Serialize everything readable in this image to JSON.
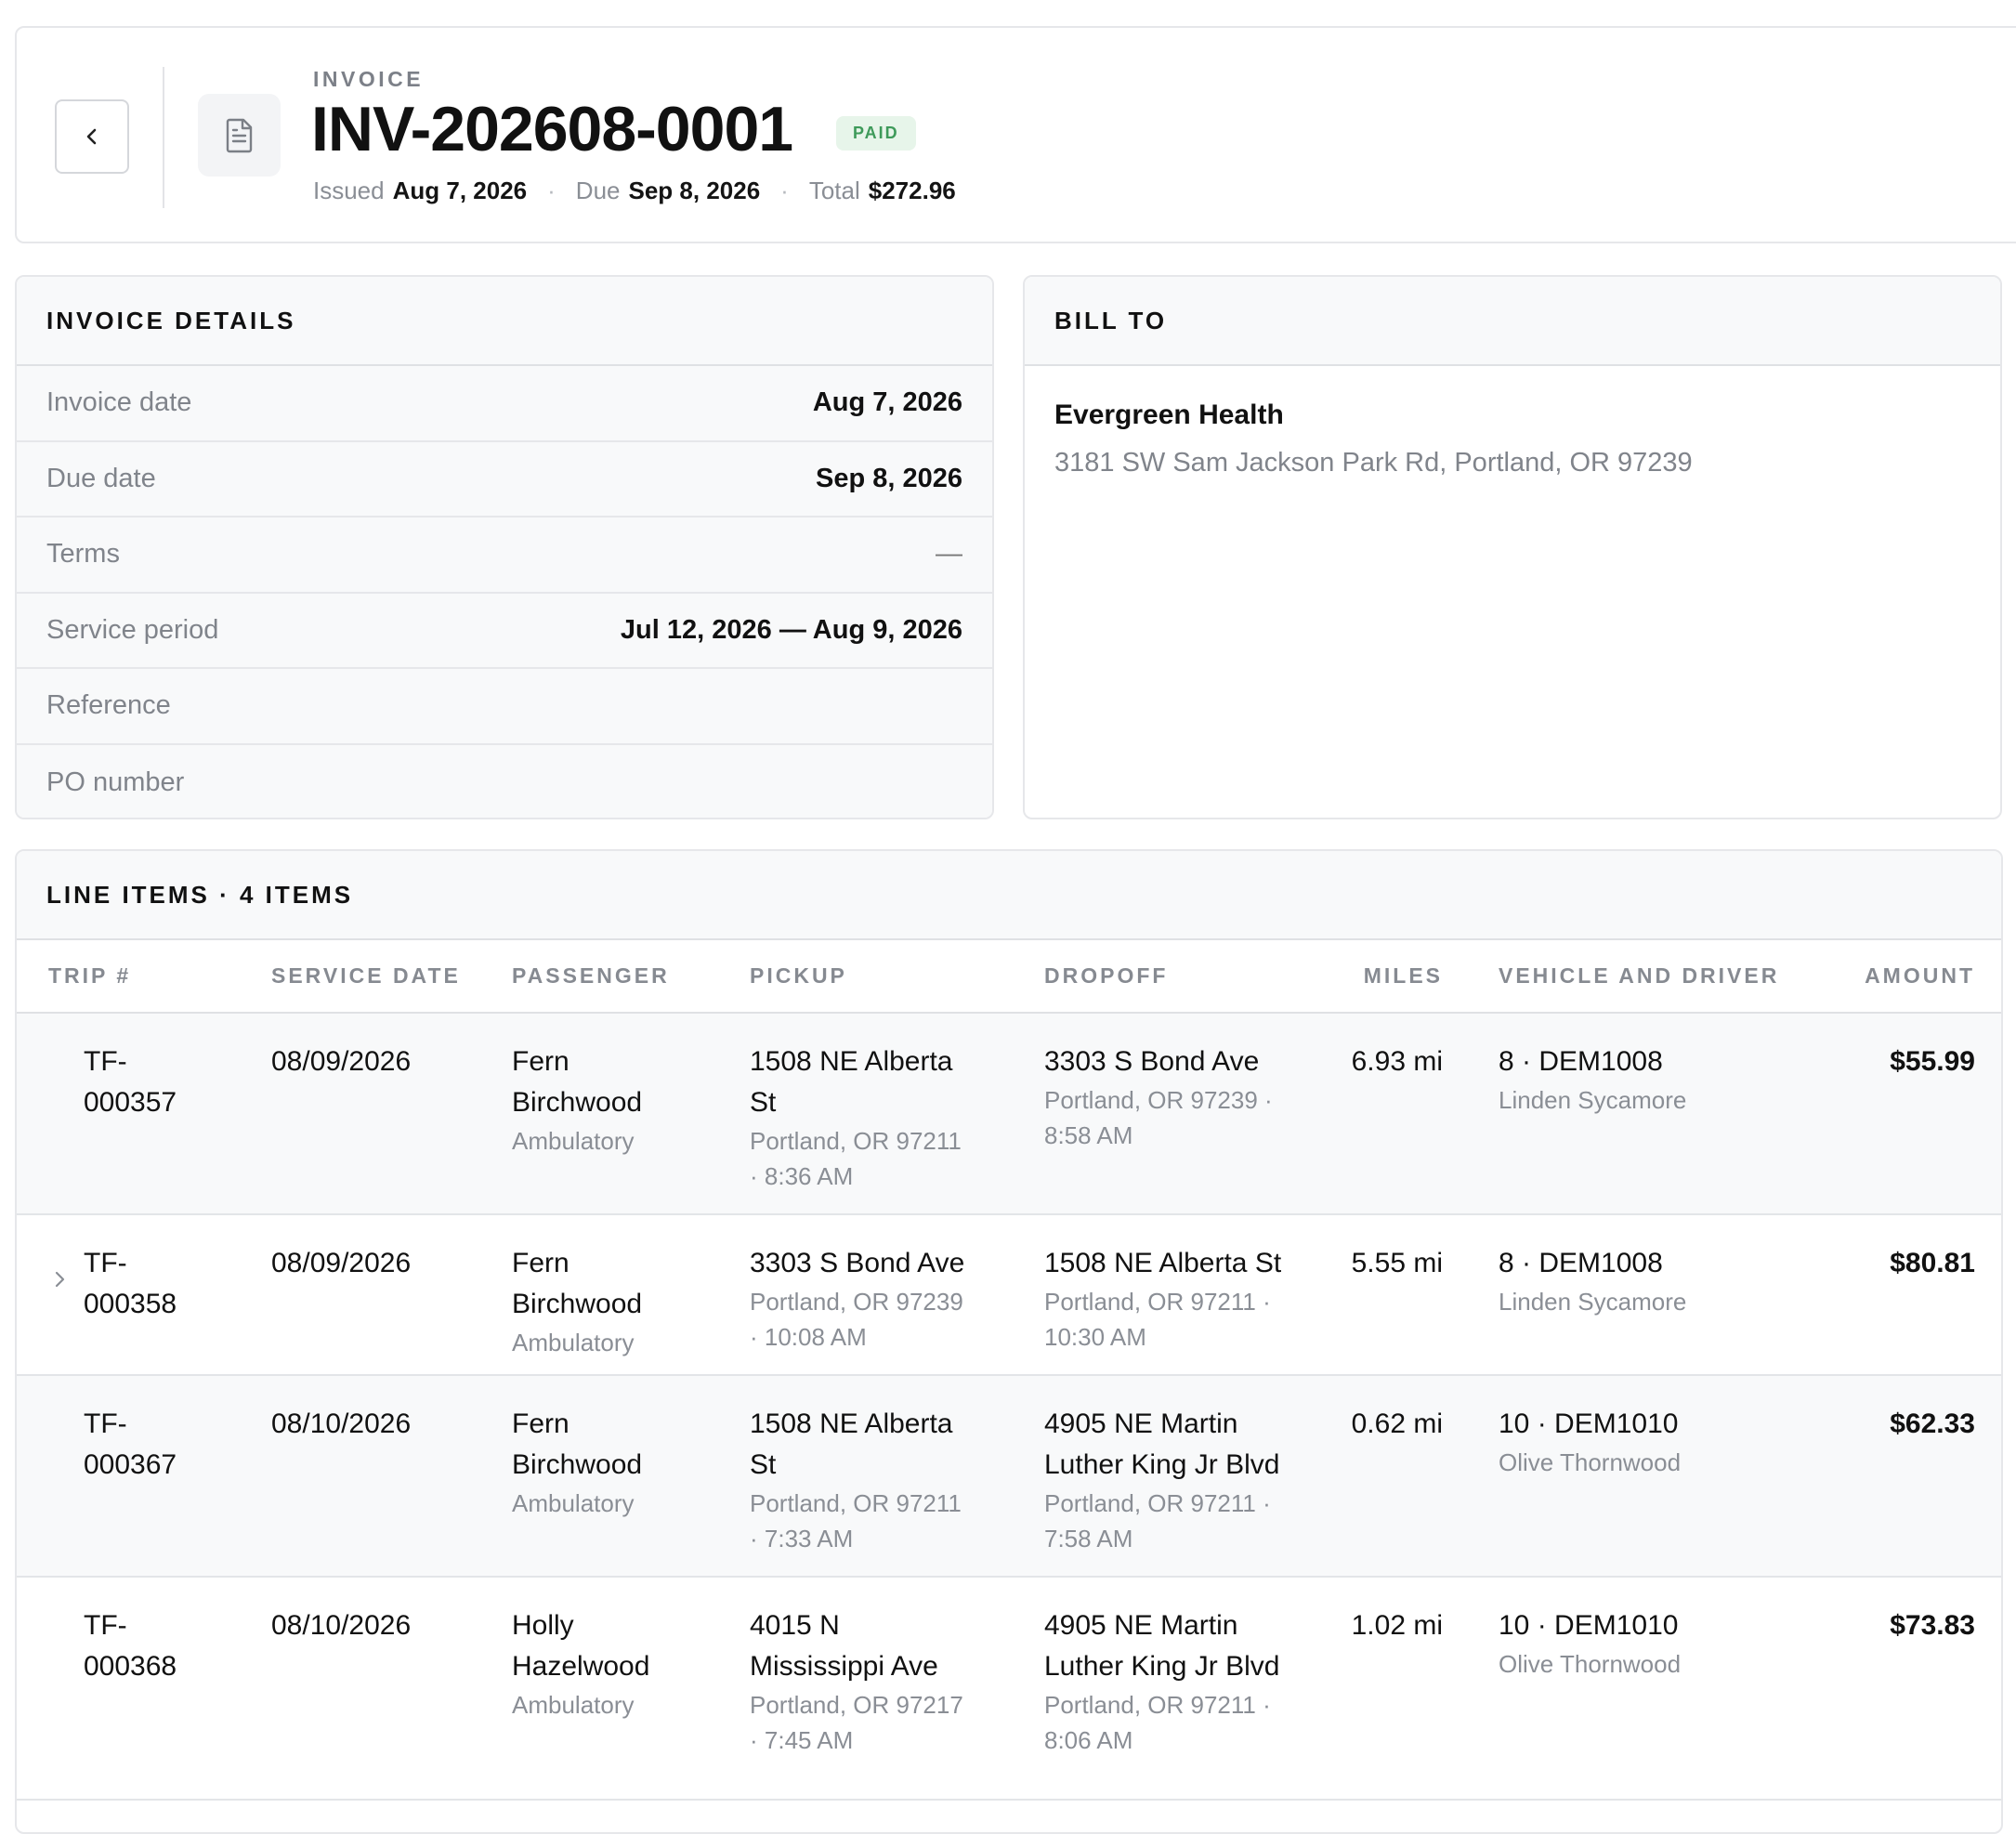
{
  "header": {
    "eyebrow": "INVOICE",
    "invoice_number": "INV-202608-0001",
    "status": "PAID",
    "issued_label": "Issued",
    "issued_value": "Aug 7, 2026",
    "due_label": "Due",
    "due_value": "Sep 8, 2026",
    "total_label": "Total",
    "total_value": "$272.96",
    "separator": "·"
  },
  "details": {
    "title": "INVOICE DETAILS",
    "rows": [
      {
        "label": "Invoice date",
        "value": "Aug 7, 2026"
      },
      {
        "label": "Due date",
        "value": "Sep 8, 2026"
      },
      {
        "label": "Terms",
        "value": "—"
      },
      {
        "label": "Service period",
        "value": "Jul 12, 2026 — Aug 9, 2026"
      },
      {
        "label": "Reference",
        "value": ""
      },
      {
        "label": "PO number",
        "value": ""
      }
    ]
  },
  "bill_to": {
    "title": "BILL TO",
    "name": "Evergreen Health",
    "address": "3181 SW Sam Jackson Park Rd, Portland, OR 97239"
  },
  "line_items": {
    "title": "LINE ITEMS · 4 ITEMS",
    "columns": {
      "trip": "TRIP #",
      "service_date": "SERVICE DATE",
      "passenger": "PASSENGER",
      "pickup": "PICKUP",
      "dropoff": "DROPOFF",
      "miles": "MILES",
      "vehicle_driver": "VEHICLE AND DRIVER",
      "amount": "AMOUNT"
    },
    "rows": [
      {
        "trip_a": "TF-",
        "trip_b": "000357",
        "service_date": "08/09/2026",
        "passenger_a": "Fern",
        "passenger_b": "Birchwood",
        "passenger_type": "Ambulatory",
        "pickup_a": "1508 NE Alberta",
        "pickup_b": "St",
        "pickup_city": "Portland, OR 97211",
        "pickup_time": "· 8:36 AM",
        "dropoff_a": "3303 S Bond Ave",
        "dropoff_b": "",
        "dropoff_city": "Portland, OR 97239 ·",
        "dropoff_time": "8:58 AM",
        "miles": "6.93 mi",
        "vehicle": "8 · DEM1008",
        "driver": "Linden Sycamore",
        "amount": "$55.99"
      },
      {
        "trip_a": "TF-",
        "trip_b": "000358",
        "service_date": "08/09/2026",
        "passenger_a": "Fern",
        "passenger_b": "Birchwood",
        "passenger_type": "Ambulatory",
        "pickup_a": "3303 S Bond Ave",
        "pickup_b": "",
        "pickup_city": "Portland, OR 97239",
        "pickup_time": "· 10:08 AM",
        "dropoff_a": "1508 NE Alberta St",
        "dropoff_b": "",
        "dropoff_city": "Portland, OR 97211 ·",
        "dropoff_time": "10:30 AM",
        "miles": "5.55 mi",
        "vehicle": "8 · DEM1008",
        "driver": "Linden Sycamore",
        "amount": "$80.81"
      },
      {
        "trip_a": "TF-",
        "trip_b": "000367",
        "service_date": "08/10/2026",
        "passenger_a": "Fern",
        "passenger_b": "Birchwood",
        "passenger_type": "Ambulatory",
        "pickup_a": "1508 NE Alberta",
        "pickup_b": "St",
        "pickup_city": "Portland, OR 97211",
        "pickup_time": "· 7:33 AM",
        "dropoff_a": "4905 NE Martin",
        "dropoff_b": "Luther King Jr Blvd",
        "dropoff_city": "Portland, OR 97211 ·",
        "dropoff_time": "7:58 AM",
        "miles": "0.62 mi",
        "vehicle": "10 · DEM1010",
        "driver": "Olive Thornwood",
        "amount": "$62.33"
      },
      {
        "trip_a": "TF-",
        "trip_b": "000368",
        "service_date": "08/10/2026",
        "passenger_a": "Holly",
        "passenger_b": "Hazelwood",
        "passenger_type": "Ambulatory",
        "pickup_a": "4015 N",
        "pickup_b": "Mississippi Ave",
        "pickup_city": "Portland, OR 97217",
        "pickup_time": "· 7:45 AM",
        "dropoff_a": "4905 NE Martin",
        "dropoff_b": "Luther King Jr Blvd",
        "dropoff_city": "Portland, OR 97211 ·",
        "dropoff_time": "8:06 AM",
        "miles": "1.02 mi",
        "vehicle": "10 · DEM1010",
        "driver": "Olive Thornwood",
        "amount": "$73.83"
      }
    ]
  },
  "icons": {
    "back": "chevron-left-icon",
    "document": "document-icon",
    "expand": "chevron-right-icon"
  },
  "colors": {
    "paid_badge_bg": "#e7f5ea",
    "paid_badge_text": "#3e9a5a"
  }
}
